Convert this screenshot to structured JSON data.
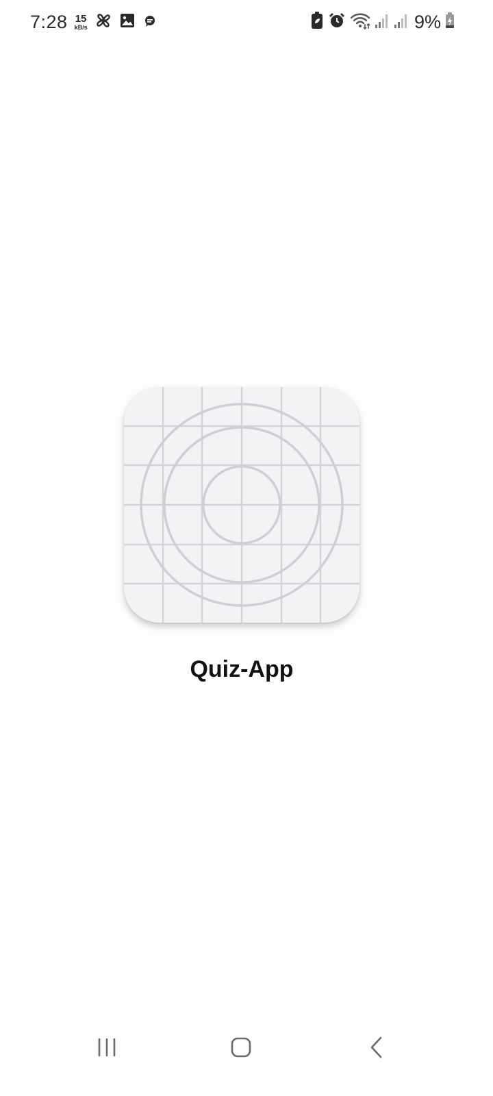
{
  "status_bar": {
    "time": "7:28",
    "net_speed_value": "15",
    "net_speed_unit": "kB/s",
    "left_icons": [
      "pinwheel-icon",
      "gallery-icon",
      "messenger-icon"
    ],
    "right_icons": [
      "battery-saver-icon",
      "alarm-icon",
      "wifi-icon",
      "signal-icon",
      "signal-icon"
    ],
    "battery_percent": "9%"
  },
  "splash": {
    "app_icon": "default-adaptive-icon-grid",
    "app_name": "Quiz-App"
  },
  "nav_bar": {
    "buttons": [
      "recent-apps",
      "home",
      "back"
    ]
  },
  "colors": {
    "background": "#fdfdfd",
    "icon_bg": "#f3f3f5",
    "icon_lines": "#d4d4d8",
    "text": "#111111",
    "nav_icons": "#6b6b6b"
  }
}
